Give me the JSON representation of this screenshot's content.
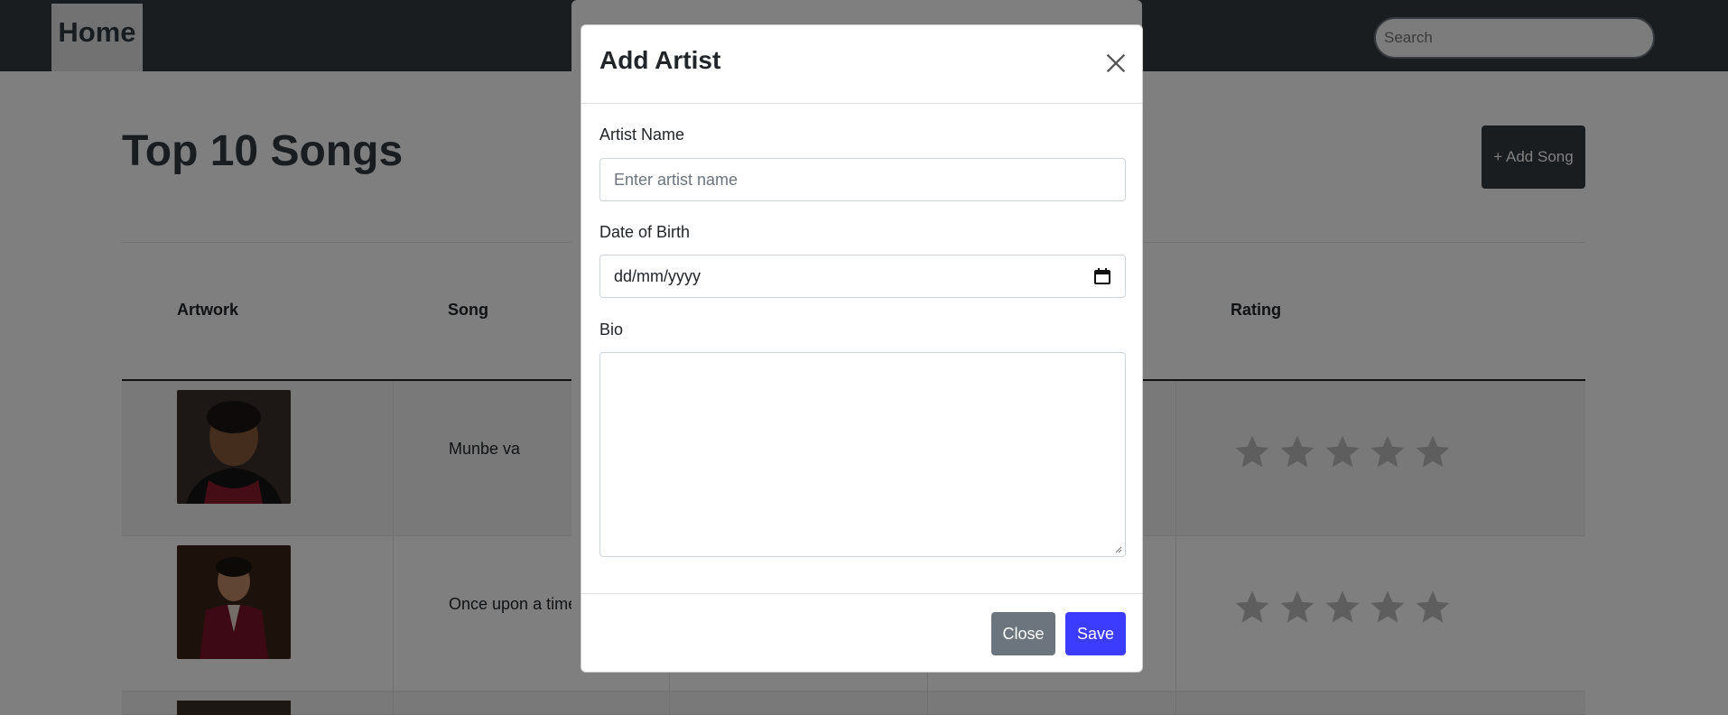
{
  "navbar": {
    "home_label": "Home",
    "search_placeholder": "Search"
  },
  "page": {
    "title": "Top 10 Songs",
    "add_song_label": "+ Add Song",
    "table": {
      "headers": [
        "Artwork",
        "Song",
        "Rating"
      ],
      "rows": [
        {
          "song": "Munbe va",
          "rating": 0
        },
        {
          "song": "Once upon a time",
          "rating": 0
        }
      ]
    }
  },
  "modal": {
    "title": "Add Artist",
    "fields": {
      "artist_name_label": "Artist Name",
      "artist_name_placeholder": "Enter artist name",
      "dob_label": "Date of Birth",
      "dob_value": "dd/mm/yyyy",
      "bio_label": "Bio"
    },
    "close_label": "Close",
    "save_label": "Save"
  },
  "colors": {
    "navbar": "#343a40",
    "save_button": "#3c3cff",
    "close_button": "#6c757d"
  },
  "icons": {
    "close": "close-icon",
    "calendar": "calendar-icon",
    "star": "star-icon",
    "resize": "resize-grip-icon"
  }
}
